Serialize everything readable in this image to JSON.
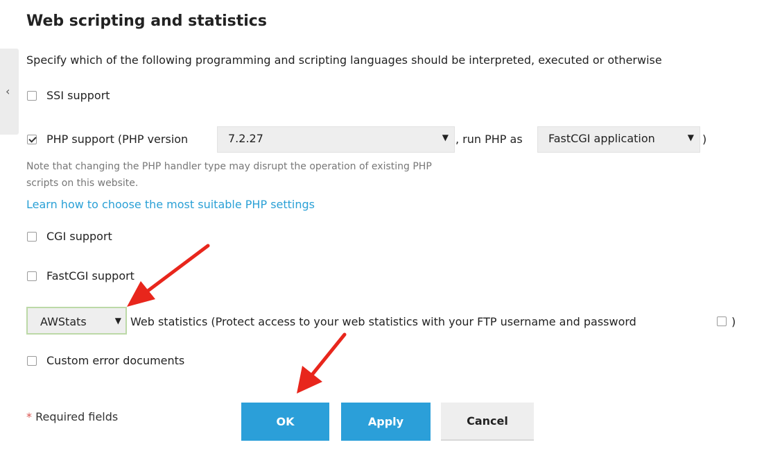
{
  "section": {
    "title": "Web scripting and statistics",
    "description": "Specify which of the following programming and scripting languages should be interpreted, executed or otherwise"
  },
  "sidebar": {
    "collapse_icon": "chevron-left-icon"
  },
  "ssi": {
    "label": "SSI support",
    "checked": false
  },
  "php": {
    "label_prefix": "PHP support (PHP version",
    "version": "7.2.27",
    "mid_text": ", run PHP as",
    "handler": "FastCGI application",
    "suffix": ")",
    "checked": true,
    "note_line1": "Note that changing the PHP handler type may disrupt the operation of existing PHP",
    "note_line2": "scripts on this website.",
    "help_link": "Learn how to choose the most suitable PHP settings"
  },
  "cgi": {
    "label": "CGI support",
    "checked": false
  },
  "fastcgi": {
    "label": "FastCGI support",
    "checked": false
  },
  "stats": {
    "selected": "AWStats",
    "label": "Web statistics (Protect access to your web statistics with your FTP username and password",
    "suffix": ")",
    "protect_checked": false
  },
  "custom_errors": {
    "label": "Custom error documents",
    "checked": false
  },
  "footer": {
    "required_star": "*",
    "required_text": " Required fields",
    "ok_label": "OK",
    "apply_label": "Apply",
    "cancel_label": "Cancel"
  },
  "annotation_color": "#e8261c"
}
